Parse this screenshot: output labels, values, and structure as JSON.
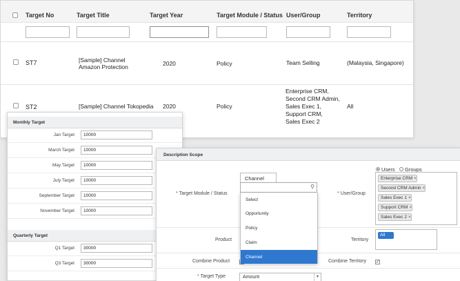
{
  "targets_table": {
    "headers": [
      "Target No",
      "Target Title",
      "Target Year",
      "Target Module / Status",
      "User/Group",
      "Territory"
    ],
    "rows": [
      {
        "target_no": "ST7",
        "title_line1": "[Sample] Channel",
        "title_line2": "Amazon Protection",
        "year": "2020",
        "module": "Policy",
        "user_group": [
          "Team Selling"
        ],
        "territory": "(Malaysia, Singapore)"
      },
      {
        "target_no": "ST2",
        "title_line1": "[Sample] Channel Tokopedia",
        "title_line2": "",
        "year": "2020",
        "module": "Policy",
        "user_group": [
          "Enterprise CRM,",
          "Second CRM Admin,",
          "Sales Exec 1,",
          "Support CRM,",
          "Sales Exec 2"
        ],
        "territory": "All"
      }
    ]
  },
  "monthly_target": {
    "title": "Monthly Target",
    "rows": [
      {
        "label": "Jan Target",
        "value": "10000"
      },
      {
        "label": "March Target",
        "value": "10000"
      },
      {
        "label": "May Target",
        "value": "10000"
      },
      {
        "label": "July Target",
        "value": "10000"
      },
      {
        "label": "September Target",
        "value": "10000"
      },
      {
        "label": "November Target",
        "value": "10000"
      }
    ]
  },
  "quarterly_target": {
    "title": "Quarterly Target",
    "rows": [
      {
        "label": "Q1 Target",
        "value": "30000"
      },
      {
        "label": "Q3 Target",
        "value": "30000"
      }
    ]
  },
  "description_scope": {
    "title": "Description Scope",
    "module_label": "Target Module / Status",
    "module_tab": "Channel",
    "module_search_placeholder": "",
    "module_options": [
      "Select",
      "Opportunity",
      "Policy",
      "Claim",
      "Channel"
    ],
    "module_selected": "Channel",
    "user_group_label": "User/Group",
    "radio_users": "Users",
    "radio_groups": "Groups",
    "users_selected": [
      "Enterprise CRM",
      "Second CRM Admin",
      "Sales Exec 1",
      "Support CRM",
      "Sales Exec 2"
    ],
    "product_label": "Product",
    "territory_label": "Territory",
    "territory_selected": "All",
    "combine_product_label": "Combine Product",
    "combine_territory_label": "Combine Territory",
    "combine_territory_checked": true,
    "target_type_label": "Target Type",
    "target_type_value": "Amount",
    "required_mark": "*"
  },
  "colors": {
    "accent": "#2f78d0",
    "required": "#d9342b",
    "header_bg": "#eef0f2"
  }
}
